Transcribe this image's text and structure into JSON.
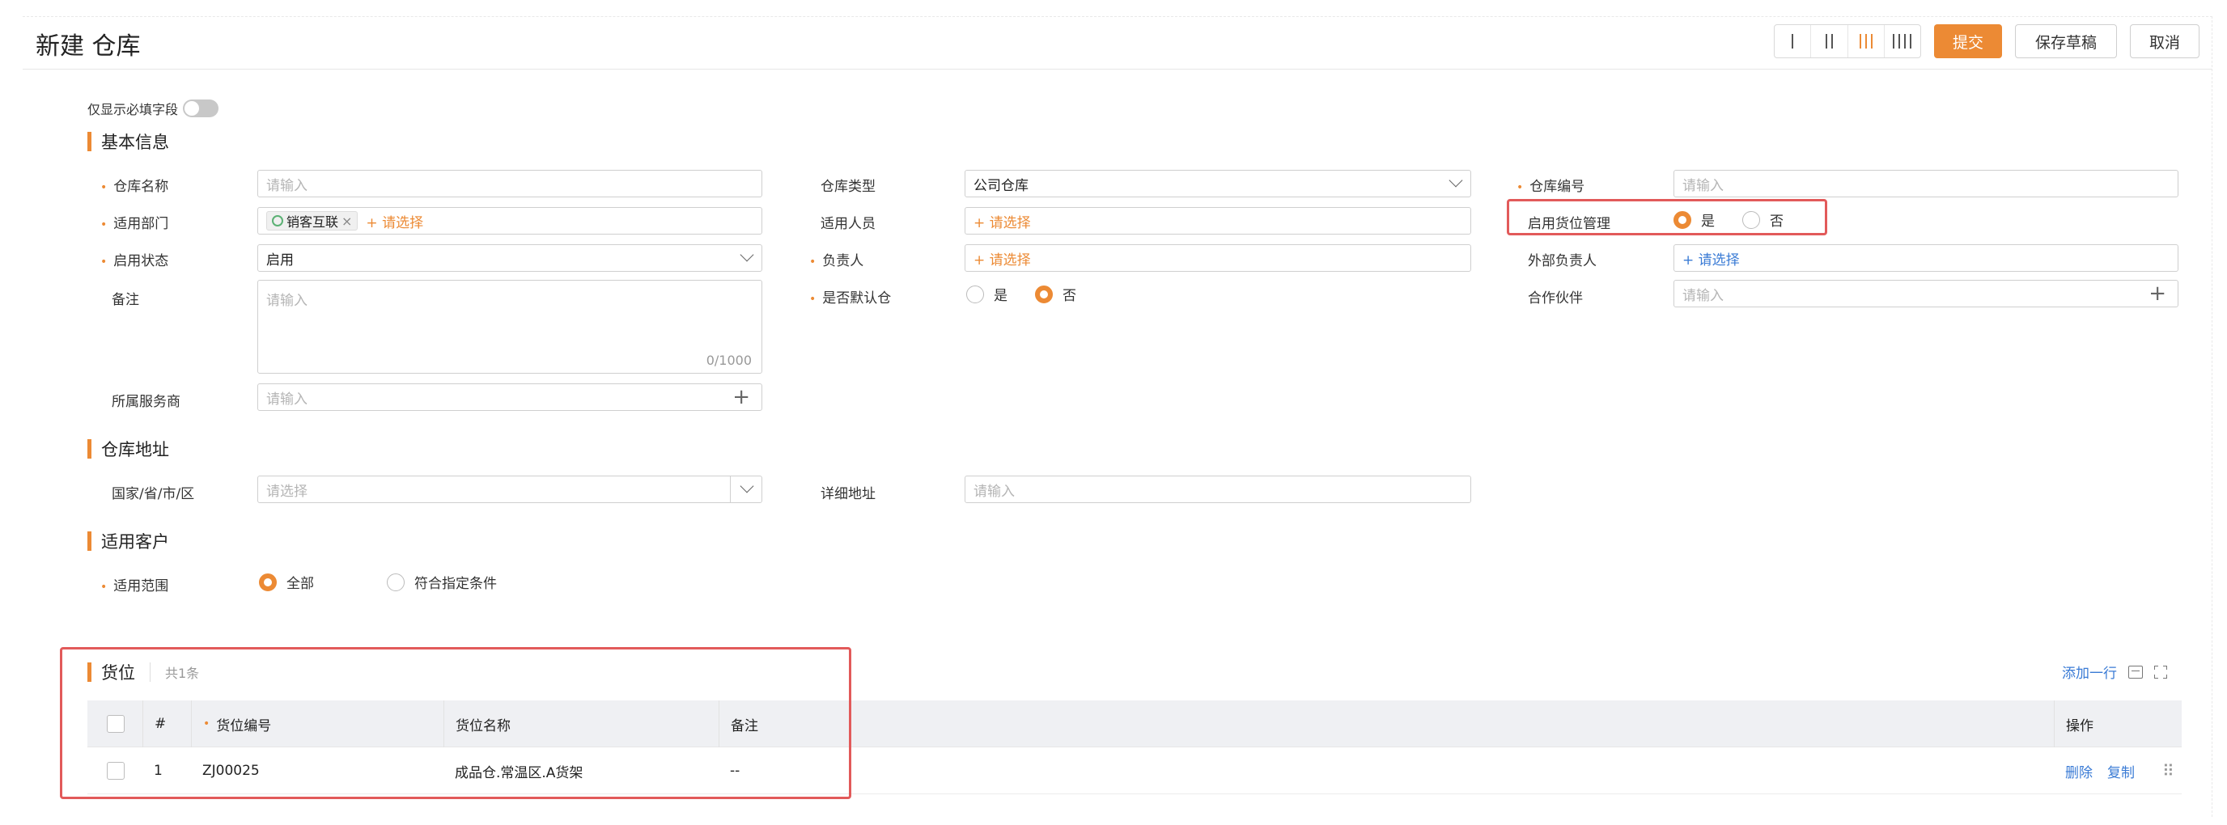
{
  "header": {
    "title": "新建 仓库",
    "layout_options": [
      "I",
      "II",
      "III",
      "IIII"
    ],
    "active_layout": 2,
    "submit_label": "提交",
    "draft_label": "保存草稿",
    "cancel_label": "取消"
  },
  "toggle": {
    "label": "仅显示必填字段",
    "on": false
  },
  "sections": {
    "basic": "基本信息",
    "address": "仓库地址",
    "customer": "适用客户",
    "location": "货位"
  },
  "form": {
    "warehouse_name": {
      "label": "仓库名称",
      "placeholder": "请输入"
    },
    "warehouse_type": {
      "label": "仓库类型",
      "value": "公司仓库"
    },
    "warehouse_code": {
      "label": "仓库编号",
      "placeholder": "请输入"
    },
    "department": {
      "label": "适用部门",
      "tag": "销客互联",
      "tag_remove": "×",
      "add": "+ 请选择"
    },
    "users": {
      "label": "适用人员",
      "add": "+ 请选择"
    },
    "location_mgmt": {
      "label": "启用货位管理",
      "yes": "是",
      "no": "否",
      "selected": "是"
    },
    "status": {
      "label": "启用状态",
      "value": "启用"
    },
    "owner": {
      "label": "负责人",
      "add": "+ 请选择"
    },
    "external_owner": {
      "label": "外部负责人",
      "add": "+ 请选择"
    },
    "remarks": {
      "label": "备注",
      "placeholder": "请输入",
      "counter": "0/1000"
    },
    "is_default": {
      "label": "是否默认仓",
      "yes": "是",
      "no": "否",
      "selected": "否"
    },
    "partner": {
      "label": "合作伙伴",
      "placeholder": "请输入",
      "plus": "+"
    },
    "service_provider": {
      "label": "所属服务商",
      "placeholder": "请输入",
      "plus": "+"
    },
    "region": {
      "label": "国家/省/市/区",
      "placeholder": "请选择"
    },
    "detail_address": {
      "label": "详细地址",
      "placeholder": "请输入"
    },
    "scope": {
      "label": "适用范围",
      "all": "全部",
      "conditional": "符合指定条件",
      "selected": "全部"
    }
  },
  "location_table": {
    "count_label": "共1条",
    "add_row": "添加一行",
    "columns": [
      "#",
      "货位编号",
      "货位名称",
      "备注",
      "操作"
    ],
    "rows": [
      {
        "index": "1",
        "code": "ZJ00025",
        "name": "成品仓.常温区.A货架",
        "note": "--",
        "delete": "删除",
        "copy": "复制"
      }
    ]
  },
  "colors": {
    "accent": "#ec8a34",
    "link": "#3a7bd5",
    "highlight": "#e25a5a",
    "required": "#ec8a34"
  },
  "icons": {
    "required_mark": "•",
    "drag_handle": "⠿"
  }
}
